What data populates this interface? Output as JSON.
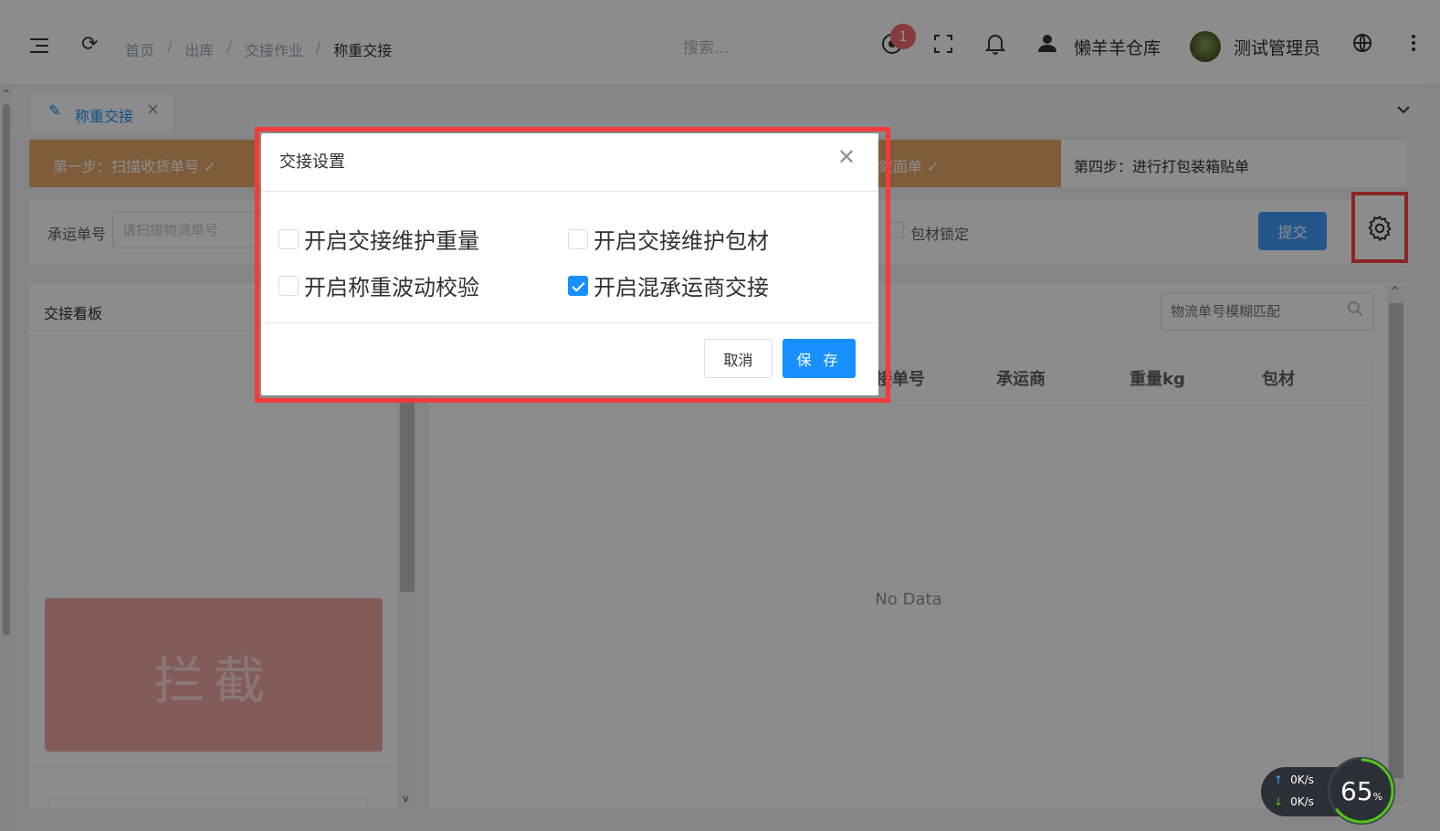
{
  "header": {
    "breadcrumb": [
      "首页",
      "出库",
      "交接作业",
      "称重交接"
    ],
    "search_placeholder": "搜索...",
    "notification_count": "1",
    "warehouse": "懒羊羊仓库",
    "user": "测试管理员"
  },
  "tabs": [
    {
      "label": "称重交接"
    }
  ],
  "steps": {
    "step1": "第一步：扫描收货单号 ✓",
    "step3": "敛面单 ✓",
    "step4": "第四步：进行打包装箱贴单"
  },
  "form": {
    "label": "承运单号",
    "placeholder": "请扫描物流单号",
    "lock_label": "包材锁定",
    "submit": "提交"
  },
  "left_panel": {
    "title": "交接看板",
    "intercept": "拦截"
  },
  "right_panel": {
    "search_placeholder": "物流单号模糊匹配",
    "columns": [
      "接单号",
      "承运商",
      "重量kg",
      "包材"
    ],
    "empty": "No Data"
  },
  "dialog": {
    "title": "交接设置",
    "options": [
      {
        "label": "开启交接维护重量",
        "checked": false
      },
      {
        "label": "开启交接维护包材",
        "checked": false
      },
      {
        "label": "开启称重波动校验",
        "checked": false
      },
      {
        "label": "开启混承运商交接",
        "checked": true
      }
    ],
    "cancel": "取消",
    "save": "保 存"
  },
  "net_widget": {
    "upload": "0K/s",
    "download": "0K/s",
    "percent": 65,
    "percent_label": "65",
    "percent_unit": "%"
  },
  "icons": [
    "menu-fold-icon",
    "refresh-icon",
    "record-icon",
    "fullscreen-icon",
    "bell-icon",
    "user-icon",
    "globe-icon",
    "more-icon",
    "edit-icon",
    "close-icon",
    "chevron-down-icon",
    "gear-icon",
    "search-icon"
  ],
  "colors": {
    "primary": "#1890ff",
    "step_done": "#e8a86a",
    "highlight": "#f43b3b",
    "intercept": "#f1a6a6"
  }
}
